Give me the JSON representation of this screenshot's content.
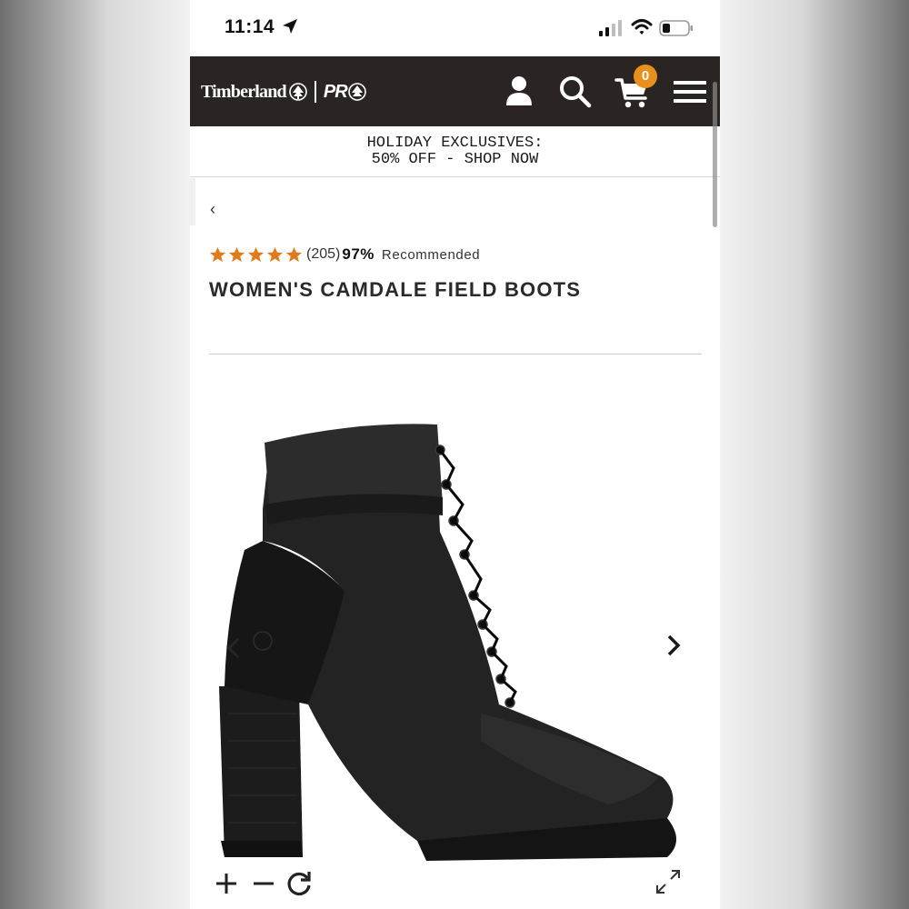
{
  "status_bar": {
    "time": "11:14",
    "icons": [
      "location-arrow-icon",
      "cellular-signal-icon",
      "wifi-icon",
      "battery-icon"
    ]
  },
  "nav": {
    "logo_text": "Timberland",
    "logo_pro": "PR",
    "cart_count": "0",
    "background": "#2a2523",
    "accent": "#e8901c",
    "icons": [
      "user-icon",
      "search-icon",
      "cart-icon",
      "menu-icon"
    ]
  },
  "promo": {
    "line1": "HOLIDAY EXCLUSIVES:",
    "line2": "50% OFF - SHOP NOW"
  },
  "product": {
    "back_label": "‹",
    "rating_stars": 5,
    "star_color": "#e07b1a",
    "review_count": "(205)",
    "recommend_pct": "97%",
    "recommend_label": "Recommended",
    "title": "WOMEN'S CAMDALE FIELD BOOTS",
    "image_alt": "black-heeled-lace-up-boot-image"
  },
  "image_controls": {
    "icons": [
      "zoom-in-icon",
      "zoom-out-icon",
      "reset-zoom-icon",
      "expand-icon",
      "chevron-left-icon",
      "chevron-right-icon"
    ]
  }
}
